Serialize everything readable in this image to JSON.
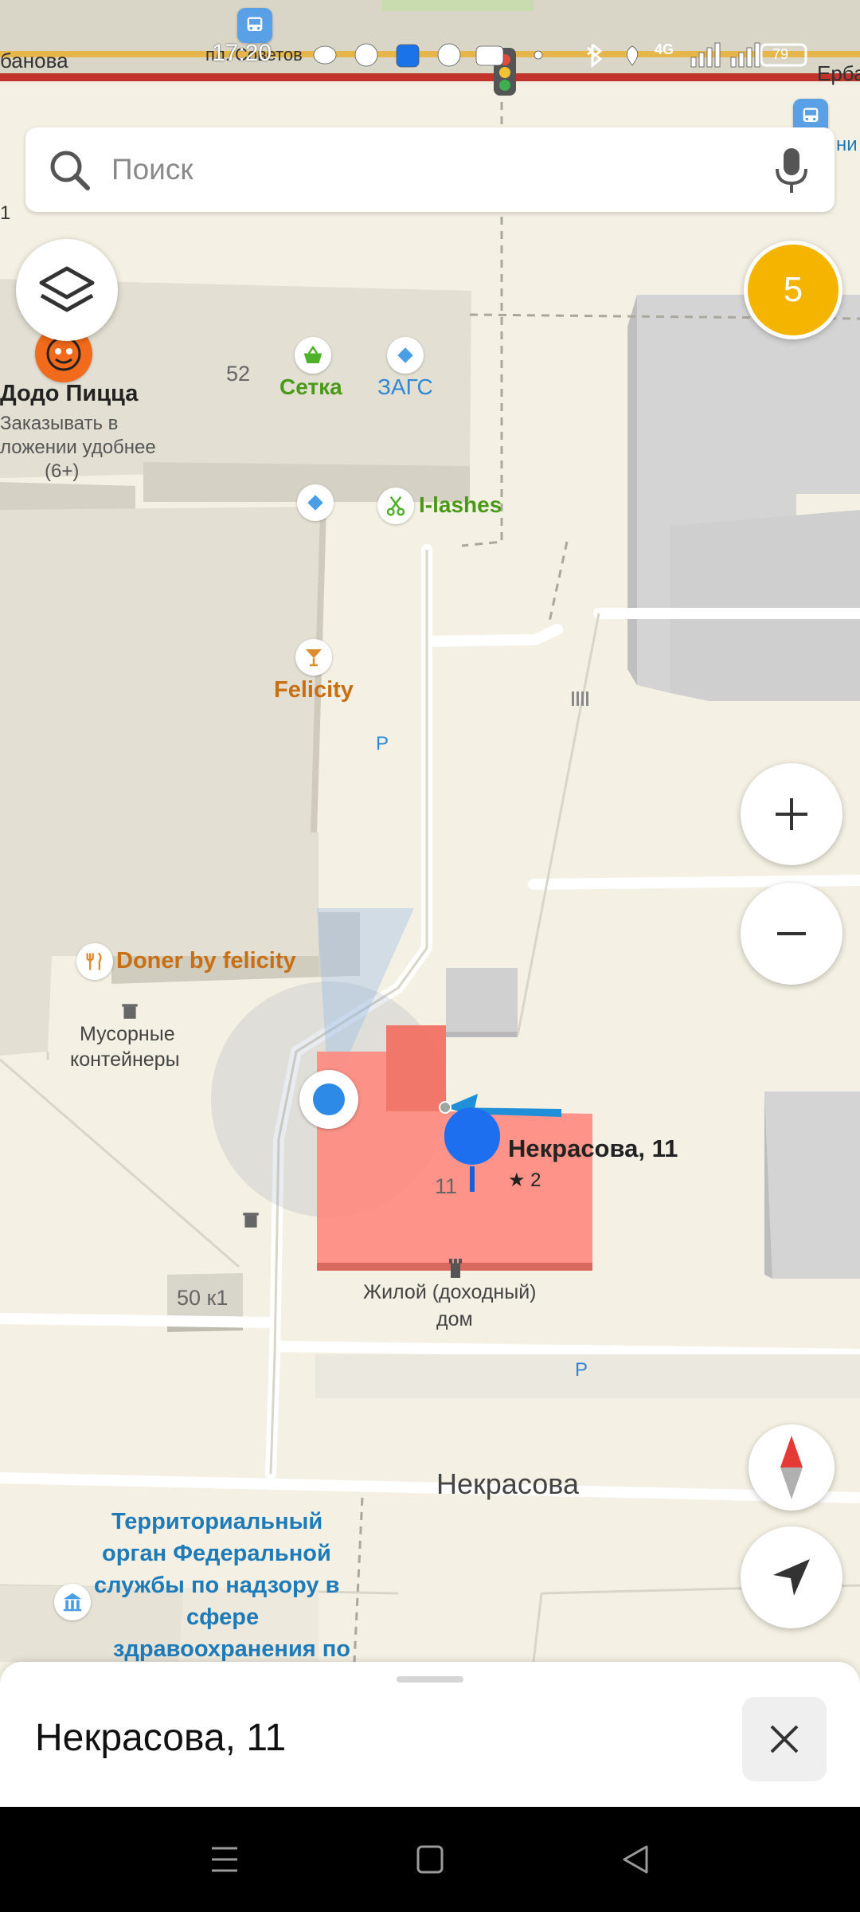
{
  "status_bar": {
    "time": "17:20",
    "battery": "79",
    "network": "4G"
  },
  "search": {
    "placeholder": "Поиск"
  },
  "traffic_level": "5",
  "map": {
    "streets": {
      "top_left": "банова",
      "top_right": "Ерба",
      "bottom": "Некрасова",
      "top_stop": "пл. Советов"
    },
    "pois": {
      "dodo": {
        "name": "Додо Пицца",
        "desc_line1": "Заказывать в",
        "desc_line2": "ложении удобнее",
        "desc_line3": "(6+)"
      },
      "setka": "Сетка",
      "zags": "ЗАГС",
      "ilashes": "I-lashes",
      "felicity": "Felicity",
      "doner": "Doner by felicity",
      "trash": {
        "line1": "Мусорные",
        "line2": "контейнеры"
      },
      "dom": {
        "line1": "Жилой (доходный)",
        "line2": "дом"
      },
      "agency": {
        "line1": "Территориальный",
        "line2": "орган Федеральной",
        "line3": "службы по надзору в",
        "line4": "сфере",
        "line5": "здравоохранения по"
      }
    },
    "house_numbers": {
      "h52": "52",
      "h50k1": "50 к1",
      "h11": "11"
    },
    "parking": {
      "p1": "P",
      "p2": "P"
    },
    "pin": {
      "title": "Некрасова, 11",
      "rating": "★ 2"
    },
    "edge_labels": {
      "left_1": "1",
      "right_stop": "ни"
    }
  },
  "bottom_sheet": {
    "title": "Некрасова, 11"
  }
}
